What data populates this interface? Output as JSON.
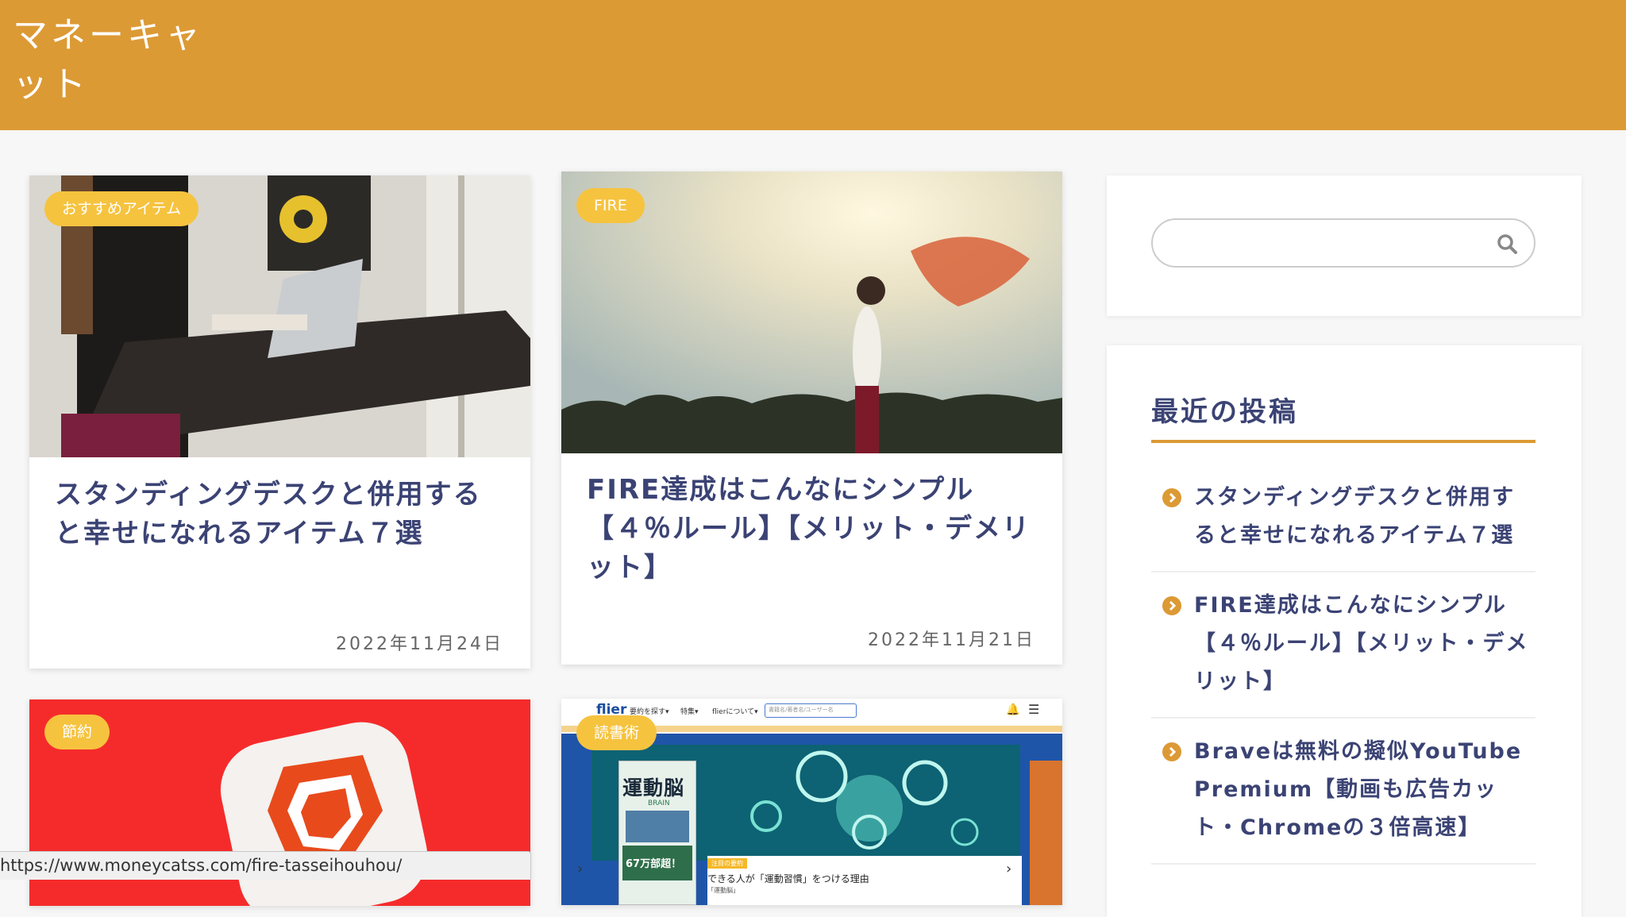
{
  "header": {
    "site_title": "マネーキャット"
  },
  "posts": [
    {
      "category": "おすすめアイテム",
      "title": "スタンディングデスクと併用すると幸せになれるアイテム７選",
      "date": "2022年11月24日"
    },
    {
      "category": "FIRE",
      "title": "FIRE達成はこんなにシンプル【４％ルール】【メリット・デメリット】",
      "date": "2022年11月21日"
    },
    {
      "category": "節約"
    },
    {
      "category": "読書術",
      "screenshot": {
        "logo": "flier",
        "nav": [
          "要約を探す▾",
          "特集▾",
          "flierについて▾"
        ],
        "search_placeholder": "書籍名/著者名/ユーザー名",
        "book_title": "運動脳",
        "book_en": "BRAIN",
        "badge": "67万部超！",
        "caption_tag": "注目の要約",
        "caption": "できる人が「運動習慣」をつける理由",
        "caption_sub": "「運動脳」"
      }
    }
  ],
  "sidebar": {
    "search_placeholder": "",
    "recent_title": "最近の投稿",
    "recent_posts": [
      "スタンディングデスクと併用すると幸せになれるアイテム７選",
      "FIRE達成はこんなにシンプル【４％ルール】【メリット・デメリット】",
      "Braveは無料の擬似YouTube Premium【動画も広告カット・Chromeの３倍高速】"
    ]
  },
  "status_url": "https://www.moneycatss.com/fire-tasseihouhou/",
  "colors": {
    "header": "#dc9a35",
    "category": "#f6c33f",
    "title": "#3b4374"
  }
}
